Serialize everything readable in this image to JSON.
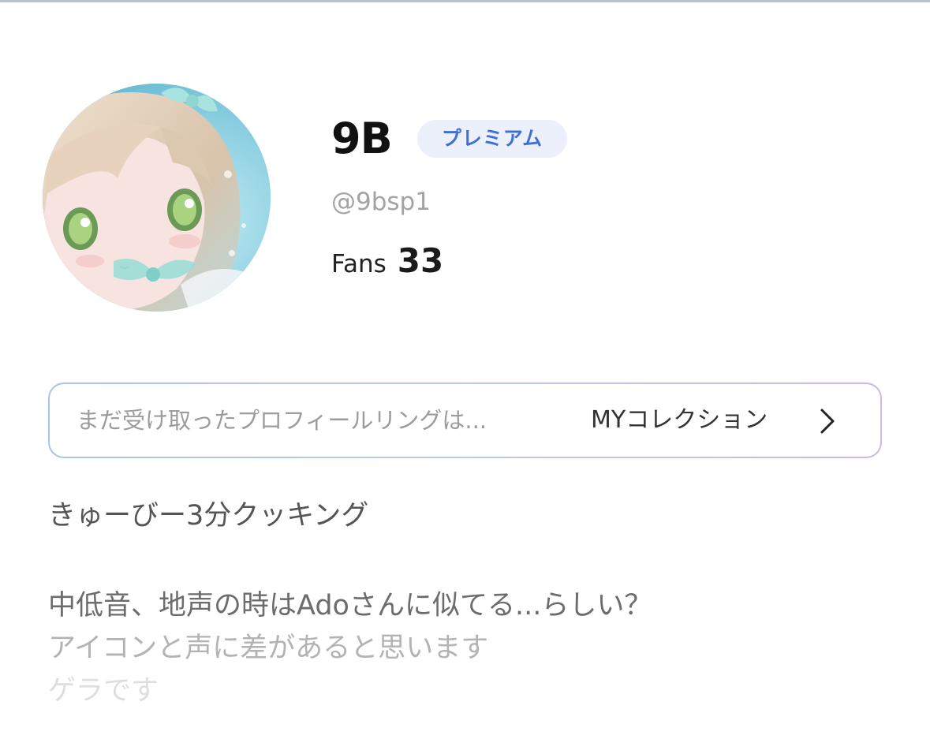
{
  "profile": {
    "name": "9B",
    "badge": "プレミアム",
    "handle": "@9bsp1",
    "fans_label": "Fans",
    "fans_count": "33",
    "avatar_icon": "avatar-illustration"
  },
  "collection": {
    "message": "まだ受け取ったプロフィールリングは...",
    "link_label": "MYコレクション",
    "chevron_icon": "chevron-right-icon"
  },
  "bio": {
    "title": "きゅーびー3分クッキング",
    "lines": [
      "中低音、地声の時はAdoさんに似てる...らしい？",
      "アイコンと声に差があると思います",
      "ゲラです"
    ]
  },
  "colors": {
    "badge_bg": "#ebf0fb",
    "badge_text": "#3f6fd6",
    "top_border": "#b9c2ca"
  }
}
